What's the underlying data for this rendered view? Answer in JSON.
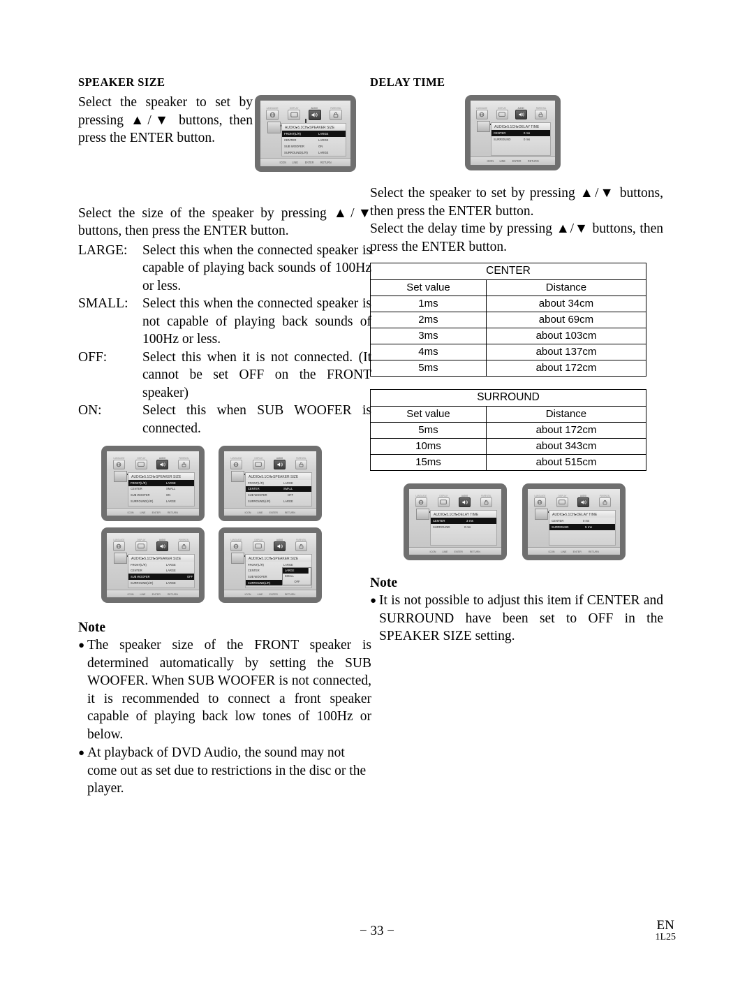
{
  "page": {
    "number": "− 33 −",
    "lang_code": "EN",
    "doc_code": "1L25"
  },
  "left_column": {
    "title": "SPEAKER SIZE",
    "intro": "Select the speaker to set by pressing ▲/▼ buttons, then press the ENTER button.",
    "instruction": "Select the size of the speaker by pressing ▲/▼ buttons, then press the ENTER button.",
    "definitions": [
      {
        "term": "LARGE:",
        "desc": "Select this when the connected speaker is capable of playing back sounds of 100Hz or less."
      },
      {
        "term": "SMALL:",
        "desc": "Select this when the connected speaker is not capable of playing back sounds of 100Hz or less."
      },
      {
        "term": "OFF:",
        "desc": "Select this when it is not connected. (It cannot be set OFF on the FRONT speaker)"
      },
      {
        "term": "ON:",
        "desc": "Select this when SUB WOOFER is connected."
      }
    ],
    "note": {
      "title": "Note",
      "items": [
        "The speaker size of the FRONT speaker is determined automatically by setting the SUB WOOFER. When SUB WOOFER is not connected, it is recommended to connect a front speaker capable of playing back low tones of 100Hz or below.",
        "At playback of DVD Audio, the sound may not come out as set due to restrictions in the disc or the player."
      ]
    }
  },
  "right_column": {
    "title": "DELAY TIME",
    "instruction_1": "Select the speaker to set by pressing ▲/▼ buttons, then press the ENTER button.",
    "instruction_2": "Select the delay time by pressing ▲/▼ buttons, then press the ENTER button.",
    "note": {
      "title": "Note",
      "items": [
        "It is not possible to adjust this item if CENTER and SURROUND have been set to OFF in the SPEAKER SIZE setting."
      ]
    }
  },
  "tables": [
    {
      "group": "CENTER",
      "headers": [
        "Set value",
        "Distance"
      ],
      "rows": [
        [
          "1ms",
          "about 34cm"
        ],
        [
          "2ms",
          "about 69cm"
        ],
        [
          "3ms",
          "about 103cm"
        ],
        [
          "4ms",
          "about 137cm"
        ],
        [
          "5ms",
          "about 172cm"
        ]
      ]
    },
    {
      "group": "SURROUND",
      "headers": [
        "Set value",
        "Distance"
      ],
      "rows": [
        [
          "5ms",
          "about 172cm"
        ],
        [
          "10ms",
          "about 343cm"
        ],
        [
          "15ms",
          "about 515cm"
        ]
      ]
    }
  ],
  "osd_common": {
    "tabs": [
      {
        "label": "LANGUAGE",
        "icon": "globe-icon"
      },
      {
        "label": "DISPLAY",
        "icon": "monitor-icon"
      },
      {
        "label": "AUDIO",
        "icon": "speaker-icon"
      },
      {
        "label": "PARENTAL",
        "icon": "lock-icon"
      }
    ],
    "selected_tab": "AUDIO",
    "footer": [
      "ICON",
      "LINE",
      "ENTER",
      "RETURN"
    ]
  },
  "osd_screens": {
    "speaker_size_main": {
      "title": "AUDIO▸5.1CH▸SPEAKER SIZE",
      "rows": [
        {
          "label": "FRONT(L/R)",
          "value": "LARGE",
          "highlight": true
        },
        {
          "label": "CENTER",
          "value": "LARGE",
          "highlight": false
        },
        {
          "label": "SUB WOOFER",
          "value": "ON",
          "highlight": false
        },
        {
          "label": "SURROUND(L/R)",
          "value": "LARGE",
          "highlight": false
        }
      ]
    },
    "speaker_size_front": {
      "title": "AUDIO▸5.1CH▸SPEAKER SIZE",
      "rows": [
        {
          "label": "FRONT(L/R)",
          "value": "LARGE",
          "highlight": true
        },
        {
          "label": "CENTER",
          "value": "SMALL",
          "highlight": false
        },
        {
          "label": "SUB WOOFER",
          "value": "ON",
          "highlight": false
        },
        {
          "label": "SURROUND(L/R)",
          "value": "LARGE",
          "highlight": false
        }
      ]
    },
    "speaker_size_center": {
      "title": "AUDIO▸5.1CH▸SPEAKER SIZE",
      "rows": [
        {
          "label": "FRONT(L/R)",
          "value": "LARGE",
          "highlight": false
        },
        {
          "label": "CENTER",
          "value": "SMALL",
          "highlight": true
        },
        {
          "label": "SUB WOOFER",
          "value": "OFF",
          "highlight": false
        },
        {
          "label": "SURROUND(L/R)",
          "value": "LARGE",
          "highlight": false
        }
      ]
    },
    "speaker_size_subwoofer": {
      "title": "AUDIO▸5.1CH▸SPEAKER SIZE",
      "rows": [
        {
          "label": "FRONT(L/R)",
          "value": "LARGE",
          "highlight": false
        },
        {
          "label": "CENTER",
          "value": "LARGE",
          "highlight": false
        },
        {
          "label": "SUB WOOFER",
          "value": "OFF",
          "highlight": true
        },
        {
          "label": "SURROUND(L/R)",
          "value": "LARGE",
          "highlight": false
        }
      ]
    },
    "speaker_size_surround": {
      "title": "AUDIO▸5.1CH▸SPEAKER SIZE",
      "rows": [
        {
          "label": "FRONT(L/R)",
          "value": "LARGE",
          "highlight": false
        },
        {
          "label": "CENTER",
          "value": "SMALL",
          "highlight": false
        },
        {
          "label": "SUB WOOFER",
          "value": "",
          "highlight": false
        },
        {
          "label": "SURROUND(L/R)",
          "value": "",
          "highlight": true
        }
      ],
      "dropdown": {
        "options": [
          "LARGE",
          "SMALL",
          "OFF"
        ],
        "selected": "LARGE"
      }
    },
    "delay_time_main": {
      "title": "AUDIO▸5.1CH▸DELAY TIME",
      "rows": [
        {
          "label": "CENTER",
          "value": "0 ms",
          "highlight": true
        },
        {
          "label": "SURROUND",
          "value": "0 ms",
          "highlight": false
        }
      ]
    },
    "delay_time_center": {
      "title": "AUDIO▸5.1CH▸DELAY TIME",
      "rows": [
        {
          "label": "CENTER",
          "value": "",
          "highlight": true
        },
        {
          "label": "SURROUND",
          "value": "0 ms",
          "highlight": false
        }
      ],
      "valuebox": "3 ms"
    },
    "delay_time_surround": {
      "title": "AUDIO▸5.1CH▸DELAY TIME",
      "rows": [
        {
          "label": "CENTER",
          "value": "0 ms",
          "highlight": false
        },
        {
          "label": "SURROUND",
          "value": "",
          "highlight": true
        }
      ],
      "valuebox": "5 ms"
    }
  }
}
